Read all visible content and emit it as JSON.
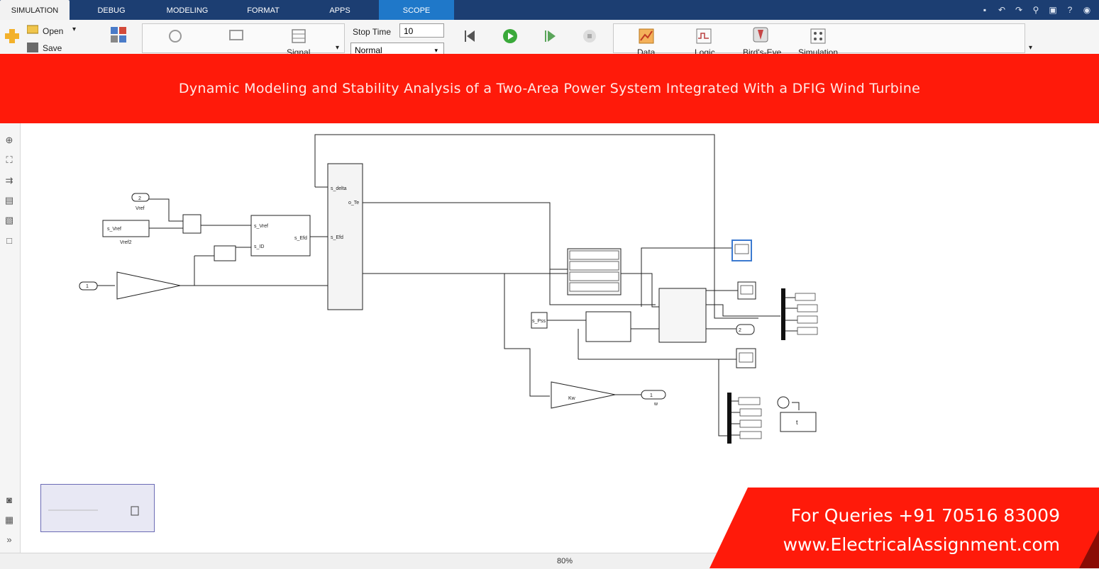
{
  "tabs": [
    {
      "label": "SIMULATION",
      "active": true
    },
    {
      "label": "DEBUG"
    },
    {
      "label": "MODELING"
    },
    {
      "label": "FORMAT"
    },
    {
      "label": "APPS"
    },
    {
      "label": "SCOPE",
      "contextual": true
    }
  ],
  "toolstrip": {
    "open_label": "Open",
    "save_label": "Save",
    "signal_label": "Signal",
    "stop_time_label": "Stop Time",
    "stop_time_value": "10",
    "sim_mode": "Normal",
    "data_label": "Data",
    "logic_label": "Logic",
    "bird_label": "Bird's-Eye",
    "simulation_label": "Simulation"
  },
  "banner": {
    "title": "Dynamic Modeling and Stability Analysis of a Two-Area Power System Integrated With a DFIG Wind Turbine"
  },
  "diagram": {
    "vref_port": "2",
    "vref_label": "Vref",
    "vref2_block": "s_Vref",
    "vref2_label": "Vref2",
    "in_port": "1",
    "exciter_ports": [
      "s_Vref",
      "s_ID",
      "s_Efd"
    ],
    "machine_ports": [
      "s_delta",
      "o_Te",
      "s_Efd"
    ],
    "pss_label": "s_Pss",
    "out_port": "1",
    "out_label": "w",
    "gain_label": "Kw",
    "port2": "2",
    "display_time": "t"
  },
  "status": {
    "zoom": "80%"
  },
  "promo": {
    "phone": "For Queries +91 70516 83009",
    "website": "www.ElectricalAssignment.com"
  },
  "colors": {
    "tabbar": "#1c3e72",
    "scope_tab": "#1f78c9",
    "banner": "#ff1a0a",
    "promo": "#ff1a0a"
  }
}
